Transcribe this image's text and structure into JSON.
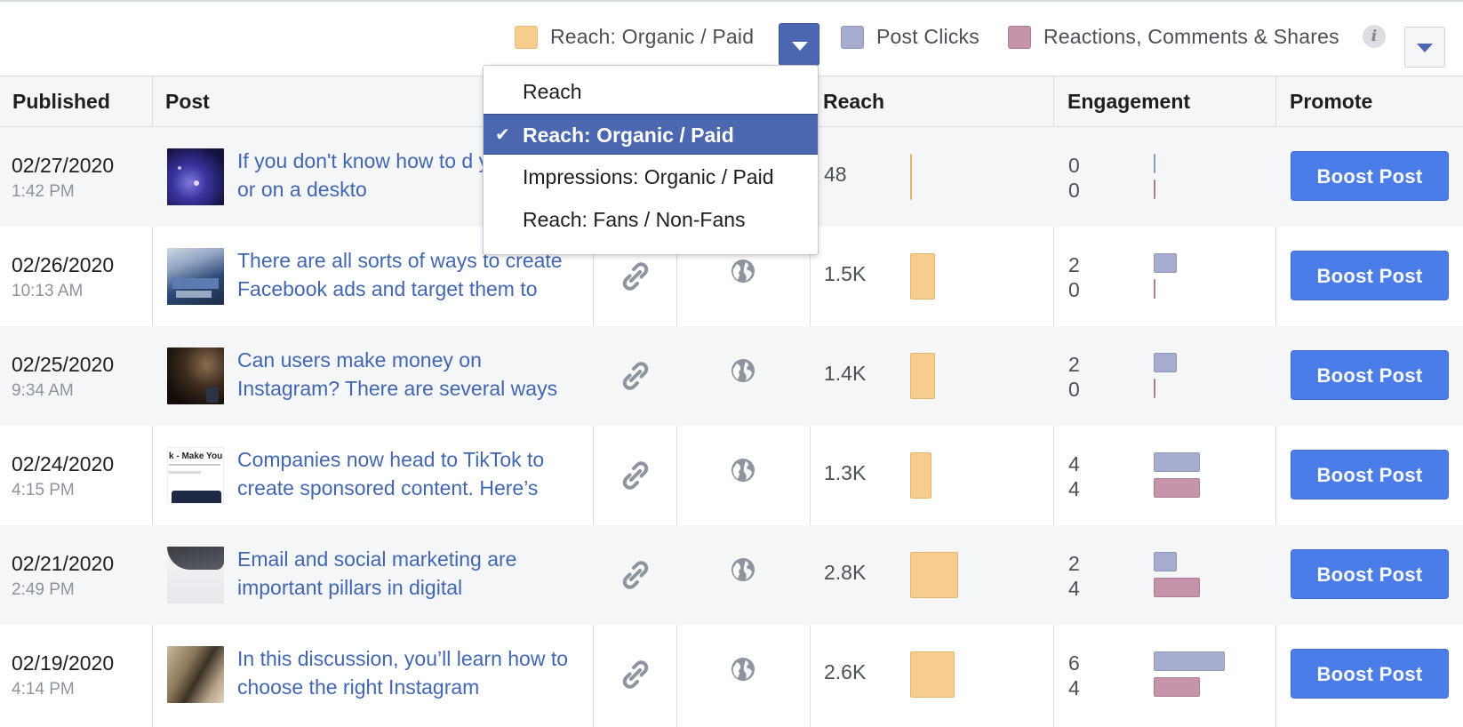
{
  "legend": {
    "items": [
      {
        "label": "Reach: Organic / Paid",
        "color": "#f6cd8d"
      },
      {
        "label": "Post Clicks",
        "color": "#a5acce"
      },
      {
        "label": "Reactions, Comments & Shares",
        "color": "#c594aa"
      }
    ],
    "info_icon": "i"
  },
  "dropdown_menu": {
    "items": [
      {
        "label": "Reach",
        "selected": false
      },
      {
        "label": "Reach: Organic / Paid",
        "selected": true
      },
      {
        "label": "Impressions: Organic / Paid",
        "selected": false
      },
      {
        "label": "Reach: Fans / Non-Fans",
        "selected": false
      }
    ],
    "check_glyph": "✔"
  },
  "table": {
    "headers": [
      "Published",
      "Post",
      "Reach",
      "Engagement",
      "Promote"
    ],
    "rows": [
      {
        "date": "02/27/2020",
        "time": "1:42 PM",
        "post": "If you don't know how to d your phone or on a deskto",
        "reach": "48",
        "reach_fraction": 0.02,
        "clicks": "0",
        "reactions": "0",
        "boost": "Boost Post"
      },
      {
        "date": "02/26/2020",
        "time": "10:13 AM",
        "post": "There are all sorts of ways to create Facebook ads and target them to",
        "reach": "1.5K",
        "reach_fraction": 0.54,
        "clicks": "2",
        "reactions": "0",
        "boost": "Boost Post"
      },
      {
        "date": "02/25/2020",
        "time": "9:34 AM",
        "post": "Can users make money on Instagram? There are several ways",
        "reach": "1.4K",
        "reach_fraction": 0.5,
        "clicks": "2",
        "reactions": "0",
        "boost": "Boost Post"
      },
      {
        "date": "02/24/2020",
        "time": "4:15 PM",
        "post": "Companies now head to TikTok to create sponsored content. Here’s",
        "reach": "1.3K",
        "reach_fraction": 0.46,
        "clicks": "4",
        "reactions": "4",
        "boost": "Boost Post"
      },
      {
        "date": "02/21/2020",
        "time": "2:49 PM",
        "post": "Email and social marketing are important pillars in digital",
        "reach": "2.8K",
        "reach_fraction": 1.0,
        "clicks": "2",
        "reactions": "4",
        "boost": "Boost Post"
      },
      {
        "date": "02/19/2020",
        "time": "4:14 PM",
        "post": "In this discussion, you’ll learn how to choose the right Instagram",
        "reach": "2.6K",
        "reach_fraction": 0.93,
        "clicks": "6",
        "reactions": "4",
        "boost": "Boost Post"
      }
    ]
  },
  "thumbnail_3_text": "k - Make Your"
}
